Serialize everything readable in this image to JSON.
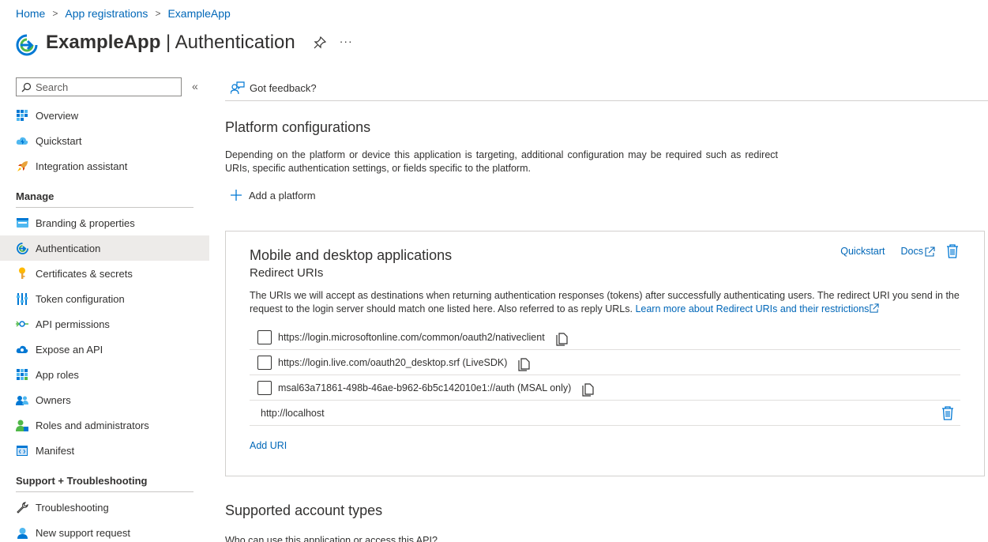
{
  "breadcrumb": {
    "home": "Home",
    "app_registrations": "App registrations",
    "app": "ExampleApp",
    "separator": ">"
  },
  "header": {
    "app_name": "ExampleApp",
    "divider": "|",
    "page_name": "Authentication",
    "more": "···"
  },
  "sidebar": {
    "search_placeholder": "Search",
    "collapse": "«",
    "top_items": [
      {
        "label": "Overview",
        "icon": "overview-icon"
      },
      {
        "label": "Quickstart",
        "icon": "quickstart-icon"
      },
      {
        "label": "Integration assistant",
        "icon": "rocket-icon"
      }
    ],
    "manage_title": "Manage",
    "manage_items": [
      {
        "label": "Branding & properties",
        "icon": "branding-icon"
      },
      {
        "label": "Authentication",
        "icon": "authentication-icon",
        "active": true
      },
      {
        "label": "Certificates & secrets",
        "icon": "key-icon"
      },
      {
        "label": "Token configuration",
        "icon": "token-icon"
      },
      {
        "label": "API permissions",
        "icon": "api-permissions-icon"
      },
      {
        "label": "Expose an API",
        "icon": "cloud-icon"
      },
      {
        "label": "App roles",
        "icon": "app-roles-icon"
      },
      {
        "label": "Owners",
        "icon": "owners-icon"
      },
      {
        "label": "Roles and administrators",
        "icon": "roles-icon"
      },
      {
        "label": "Manifest",
        "icon": "manifest-icon"
      }
    ],
    "support_title": "Support + Troubleshooting",
    "support_items": [
      {
        "label": "Troubleshooting",
        "icon": "wrench-icon"
      },
      {
        "label": "New support request",
        "icon": "support-icon"
      }
    ]
  },
  "toolbar": {
    "feedback": "Got feedback?"
  },
  "platform": {
    "title": "Platform configurations",
    "description": "Depending on the platform or device this application is targeting, additional configuration may be required such as redirect URIs, specific authentication settings, or fields specific to the platform.",
    "add_platform": "Add a platform"
  },
  "card": {
    "title": "Mobile and desktop applications",
    "subtitle": "Redirect URIs",
    "quickstart": "Quickstart",
    "docs": "Docs",
    "description": "The URIs we will accept as destinations when returning authentication responses (tokens) after successfully authenticating users. The redirect URI you send in the request to the login server should match one listed here. Also referred to as reply URLs. ",
    "learn_more": "Learn more about Redirect URIs and their restrictions",
    "uris": [
      "https://login.microsoftonline.com/common/oauth2/nativeclient",
      "https://login.live.com/oauth20_desktop.srf (LiveSDK)",
      "msal63a71861-498b-46ae-b962-6b5c142010e1://auth (MSAL only)"
    ],
    "custom_uri": "http://localhost",
    "add_uri": "Add URI"
  },
  "accounts": {
    "title": "Supported account types",
    "question": "Who can use this application or access this API?"
  },
  "colors": {
    "link": "#0067b8",
    "active_bg": "#edebe9",
    "border": "#d2d0ce",
    "text": "#323130"
  }
}
